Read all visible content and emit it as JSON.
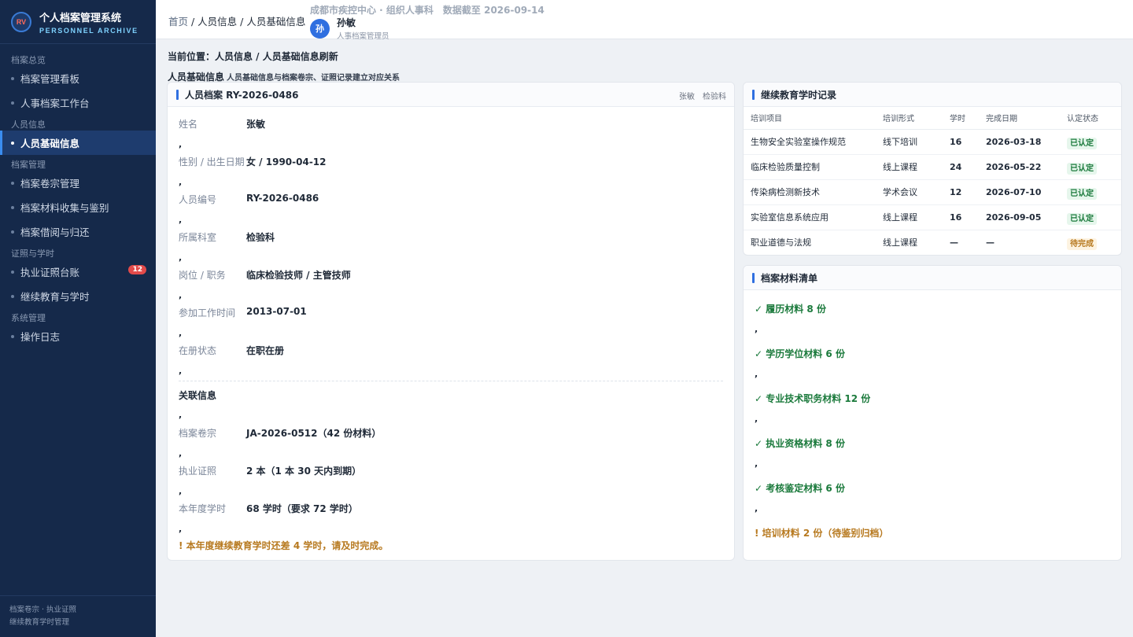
{
  "brand": {
    "logo_text": "RV",
    "title": "个人档案管理系统",
    "subtitle": "PERSONNEL ARCHIVE"
  },
  "sidebar": {
    "groups": [
      {
        "title": "档案总览",
        "items": [
          {
            "label": "档案管理看板"
          },
          {
            "label": "人事档案工作台"
          }
        ]
      },
      {
        "title": "人员信息",
        "items": [
          {
            "label": "人员基础信息"
          }
        ]
      },
      {
        "title": "档案管理",
        "items": [
          {
            "label": "档案卷宗管理"
          },
          {
            "label": "档案材料收集与鉴别"
          },
          {
            "label": "档案借阅与归还"
          }
        ]
      },
      {
        "title": "证照与学时",
        "items": [
          {
            "label": "执业证照台账",
            "badge": "12"
          },
          {
            "label": "继续教育与学时"
          }
        ]
      },
      {
        "title": "系统管理",
        "items": [
          {
            "label": "操作日志"
          }
        ]
      }
    ],
    "footer": {
      "line1": "档案卷宗 · 执业证照",
      "line2": "继续教育学时管理"
    }
  },
  "header": {
    "crumb_home": "首页",
    "crumb_rest": " / 人员信息 / 人员基础信息",
    "org_line": "成都市疾控中心 · 组织人事科　数据截至 2026-09-14",
    "user": {
      "avatar": "孙",
      "name": "孙敏",
      "role": "人事档案管理员"
    }
  },
  "main": {
    "location": "当前位置：人员信息 / 人员基础信息刷新",
    "section_title": "人员基础信息",
    "section_sub": "人员基础信息与档案卷宗、证照记录建立对应关系"
  },
  "person": {
    "title": "人员档案 RY-2026-0486",
    "actions": [
      "张敏",
      "检验科"
    ],
    "sep": ",",
    "fields": [
      {
        "label": "姓名",
        "value": "张敏"
      },
      {
        "label": "性别 / 出生日期",
        "value": "女 / 1990-04-12"
      },
      {
        "label": "人员编号",
        "value": "RY-2026-0486"
      },
      {
        "label": "所属科室",
        "value": "检验科"
      },
      {
        "label": "岗位 / 职务",
        "value": "临床检验技师 / 主管技师"
      },
      {
        "label": "参加工作时间",
        "value": "2013-07-01"
      },
      {
        "label": "在册状态",
        "value": "在职在册"
      }
    ],
    "related_title": "关联信息",
    "related": [
      {
        "label": "档案卷宗",
        "value": "JA-2026-0512（42 份材料）"
      },
      {
        "label": "执业证照",
        "value": "2 本（1 本 30 天内到期）"
      },
      {
        "label": "本年度学时",
        "value": "68 学时（要求 72 学时）"
      }
    ],
    "warning": "! 本年度继续教育学时还差 4 学时，请及时完成。"
  },
  "education": {
    "title": "继续教育学时记录",
    "columns": [
      "培训项目",
      "培训形式",
      "学时",
      "完成日期",
      "认定状态"
    ],
    "rows": [
      {
        "name": "生物安全实验室操作规范",
        "form": "线下培训",
        "hours": "16",
        "date": "2026-03-18",
        "status": "已认定",
        "state": "ok"
      },
      {
        "name": "临床检验质量控制",
        "form": "线上课程",
        "hours": "24",
        "date": "2026-05-22",
        "status": "已认定",
        "state": "ok"
      },
      {
        "name": "传染病检测新技术",
        "form": "学术会议",
        "hours": "12",
        "date": "2026-07-10",
        "status": "已认定",
        "state": "ok"
      },
      {
        "name": "实验室信息系统应用",
        "form": "线上课程",
        "hours": "16",
        "date": "2026-09-05",
        "status": "已认定",
        "state": "ok"
      },
      {
        "name": "职业道德与法规",
        "form": "线上课程",
        "hours": "—",
        "date": "—",
        "status": "待完成",
        "state": "pend"
      }
    ]
  },
  "materials": {
    "title": "档案材料清单",
    "sep": ",",
    "items": [
      {
        "text": "✓ 履历材料 8 份",
        "state": "ok"
      },
      {
        "text": "✓ 学历学位材料 6 份",
        "state": "ok"
      },
      {
        "text": "✓ 专业技术职务材料 12 份",
        "state": "ok"
      },
      {
        "text": "✓ 执业资格材料 8 份",
        "state": "ok"
      },
      {
        "text": "✓ 考核鉴定材料 6 份",
        "state": "ok"
      },
      {
        "text": "! 培训材料 2 份（待鉴别归档）",
        "state": "pend"
      }
    ]
  }
}
